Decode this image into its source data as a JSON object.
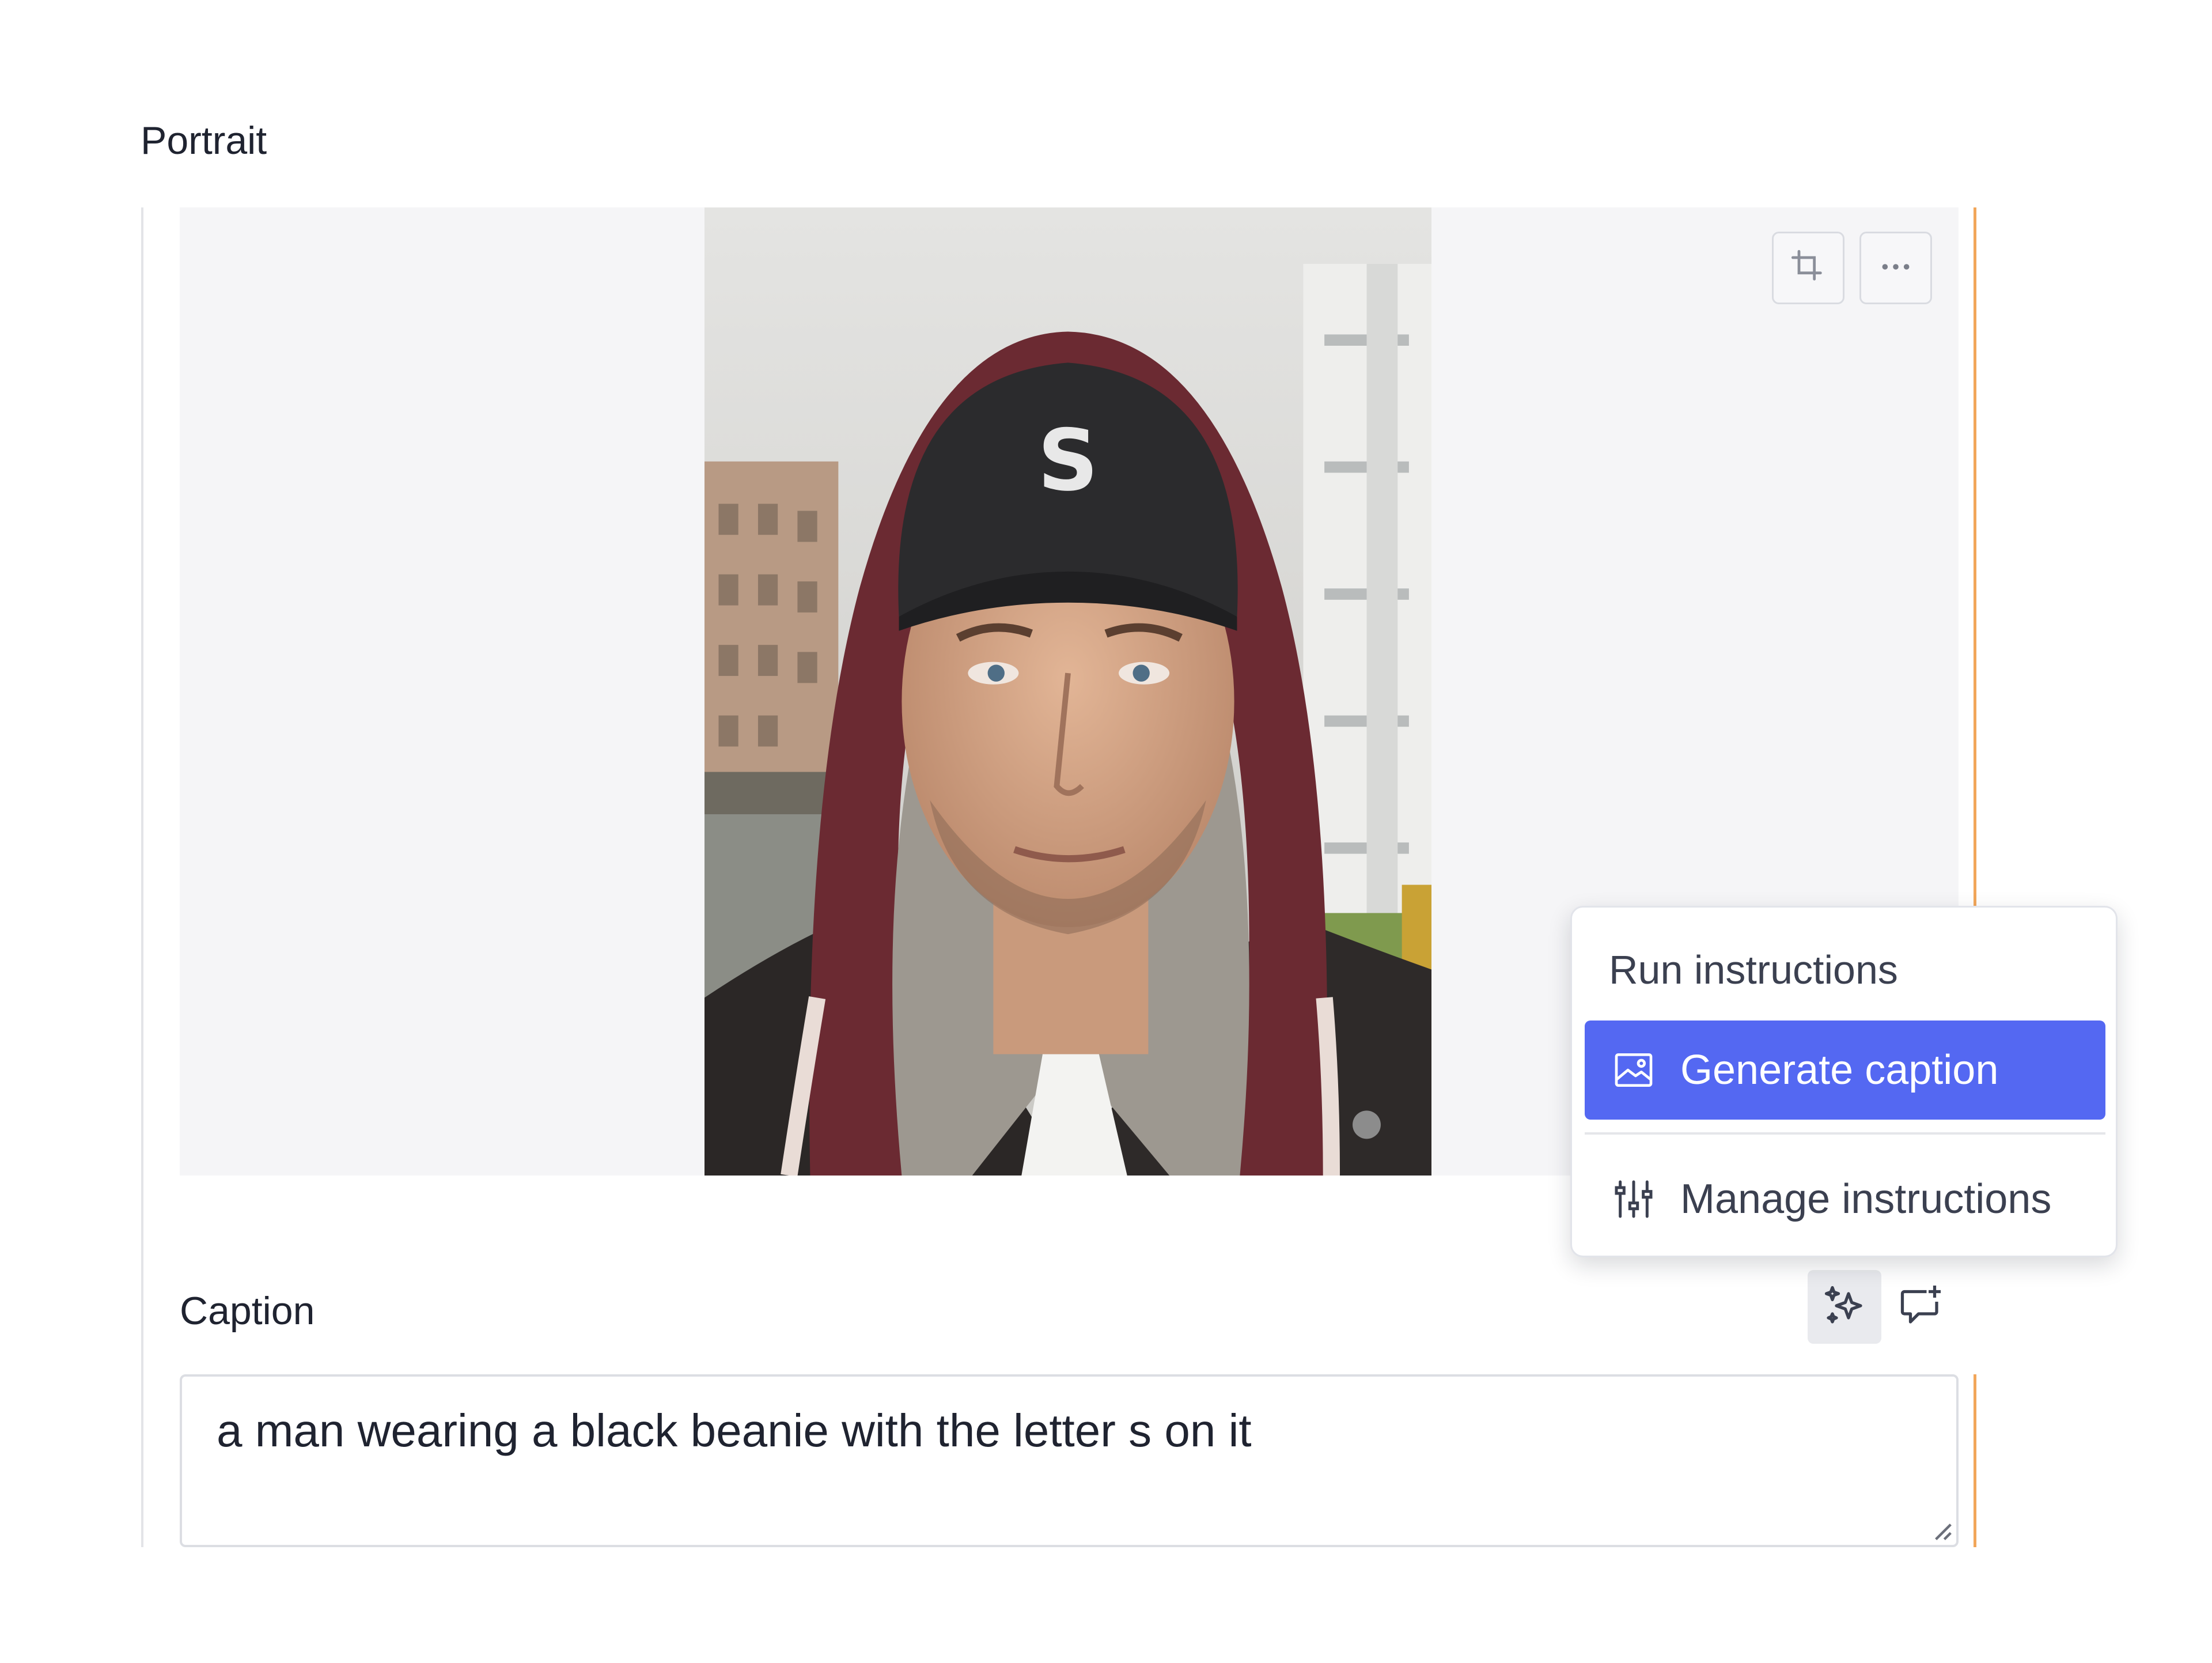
{
  "portrait": {
    "label": "Portrait",
    "photo_subject": "man wearing a black beanie and hooded jacket"
  },
  "image_toolbar": {
    "crop_icon": "crop-icon",
    "more_icon": "more-horizontal-icon"
  },
  "caption": {
    "label": "Caption",
    "value": "a man wearing a black beanie with the letter s on it"
  },
  "caption_actions": {
    "ai_icon": "sparkles-icon",
    "comment_icon": "comment-add-icon"
  },
  "dropdown": {
    "heading": "Run instructions",
    "items": [
      {
        "label": "Generate caption",
        "icon": "image-icon",
        "active": true
      },
      {
        "label": "Manage instructions",
        "icon": "sliders-icon",
        "active": false
      }
    ]
  },
  "colors": {
    "accent": "#5468f2",
    "change_indicator": "#f2a65a",
    "image_background": "#f5f5f7"
  }
}
